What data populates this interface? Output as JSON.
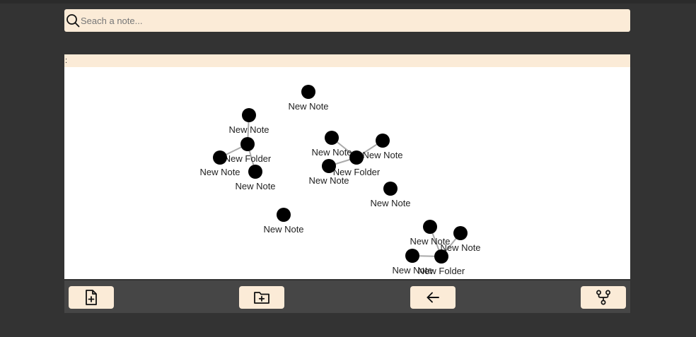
{
  "search": {
    "placeholder": "Seach a note..."
  },
  "toolbar": {
    "text": ":"
  },
  "graph": {
    "nodes": [
      {
        "id": "n1",
        "label": "New Note"
      },
      {
        "id": "n2",
        "label": "New Note"
      },
      {
        "id": "f1",
        "label": "New Folder"
      },
      {
        "id": "n3",
        "label": "New Note"
      },
      {
        "id": "n4",
        "label": "New Note"
      },
      {
        "id": "n5",
        "label": "New Note"
      },
      {
        "id": "n6",
        "label": "New Note"
      },
      {
        "id": "f2",
        "label": "New Folder"
      },
      {
        "id": "n7",
        "label": "New Note"
      },
      {
        "id": "n8",
        "label": "New Note"
      },
      {
        "id": "n9",
        "label": "New Note"
      },
      {
        "id": "n10",
        "label": "New Note"
      },
      {
        "id": "n11",
        "label": "New Note"
      },
      {
        "id": "n12",
        "label": "New Note"
      },
      {
        "id": "f3",
        "label": "New Folder"
      }
    ],
    "links": [
      [
        "n2",
        "f1"
      ],
      [
        "n3",
        "f1"
      ],
      [
        "n4",
        "f1"
      ],
      [
        "n6",
        "f2"
      ],
      [
        "n7",
        "f2"
      ],
      [
        "n8",
        "f2"
      ],
      [
        "n10",
        "f3"
      ],
      [
        "n11",
        "f3"
      ],
      [
        "n12",
        "f3"
      ]
    ]
  },
  "bottom_bar": {
    "buttons": [
      {
        "name": "new-note-button",
        "icon": "file-plus-icon"
      },
      {
        "name": "new-folder-button",
        "icon": "folder-plus-icon"
      },
      {
        "name": "back-button",
        "icon": "arrow-left-icon"
      },
      {
        "name": "graph-view-button",
        "icon": "graph-icon"
      }
    ]
  }
}
